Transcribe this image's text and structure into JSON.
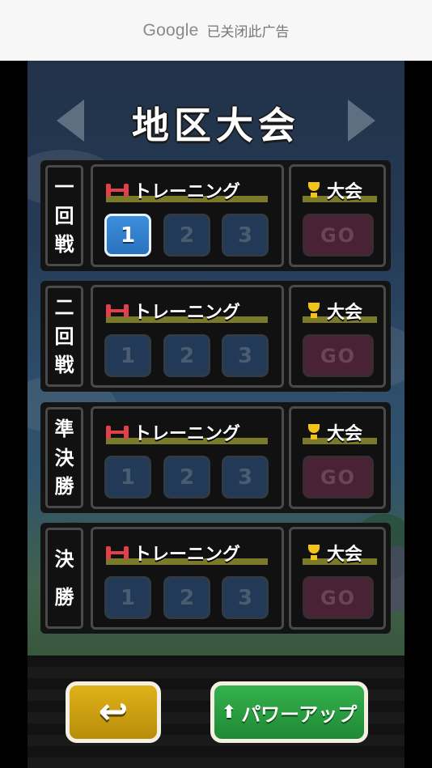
{
  "ad_banner": {
    "brand": "Google",
    "message": "已关闭此广告"
  },
  "header": {
    "title": "地区大会",
    "prev_arrow": "left-arrow-icon",
    "next_arrow": "right-arrow-icon"
  },
  "rounds": [
    {
      "label": [
        "一",
        "回",
        "戦"
      ],
      "training_label": "トレーニング",
      "contest_label": "大会",
      "buttons": [
        "1",
        "2",
        "3"
      ],
      "active_button": 1,
      "go_label": "GO"
    },
    {
      "label": [
        "二",
        "回",
        "戦"
      ],
      "training_label": "トレーニング",
      "contest_label": "大会",
      "buttons": [
        "1",
        "2",
        "3"
      ],
      "active_button": 0,
      "go_label": "GO"
    },
    {
      "label": [
        "準",
        "決",
        "勝"
      ],
      "training_label": "トレーニング",
      "contest_label": "大会",
      "buttons": [
        "1",
        "2",
        "3"
      ],
      "active_button": 0,
      "go_label": "GO"
    },
    {
      "label": [
        "決",
        "勝"
      ],
      "training_label": "トレーニング",
      "contest_label": "大会",
      "buttons": [
        "1",
        "2",
        "3"
      ],
      "active_button": 0,
      "go_label": "GO"
    }
  ],
  "footer": {
    "back_icon": "return-arrow-icon",
    "powerup_label": "パワーアップ",
    "powerup_icon": "up-arrow-icon"
  },
  "colors": {
    "active_button": "#2c72be",
    "inactive_button": "#223a57",
    "go_button": "#4a2236",
    "back_button": "#d4a514",
    "powerup_button": "#2a9e42",
    "dumbbell": "#e0404a",
    "trophy": "#f2c419"
  }
}
